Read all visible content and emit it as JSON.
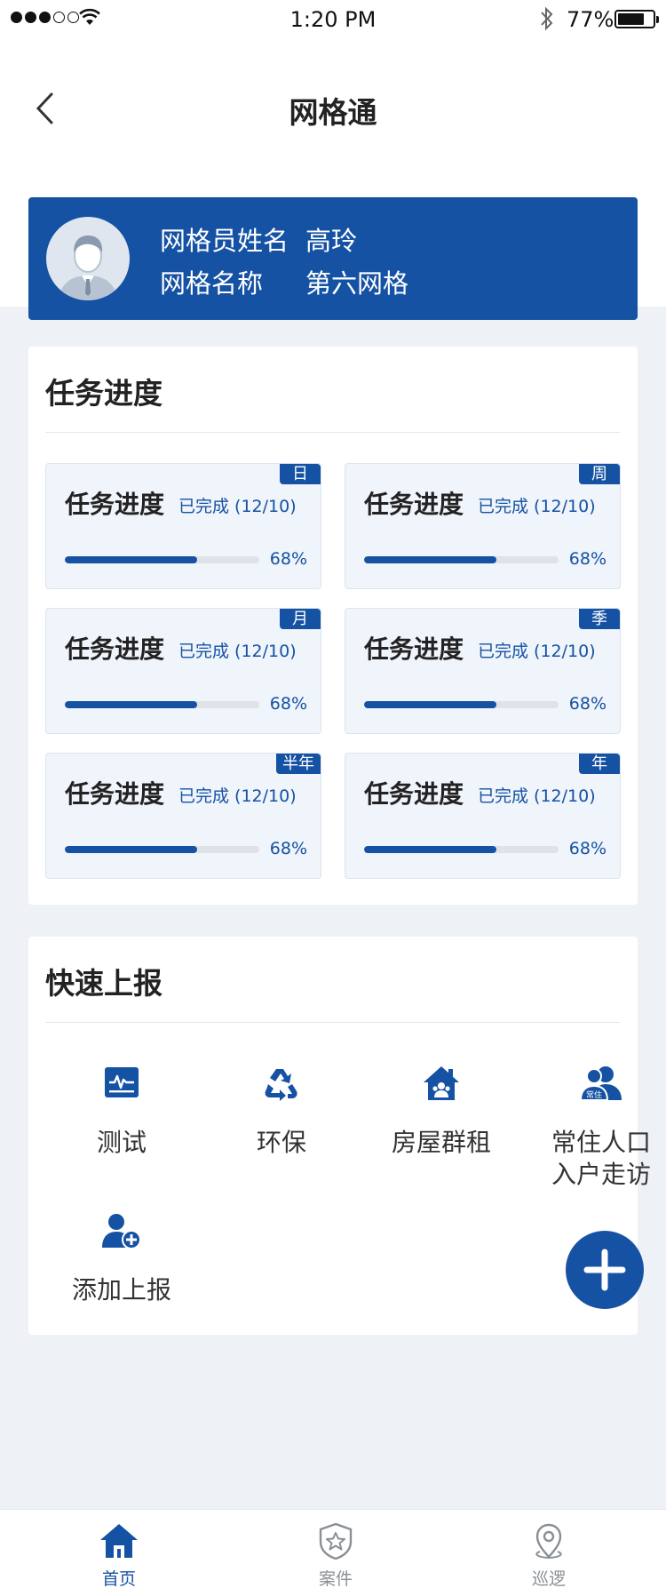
{
  "status_bar": {
    "time": "1:20 PM",
    "battery": "77%"
  },
  "nav": {
    "title": "网格通"
  },
  "profile": {
    "name_label": "网格员姓名",
    "name_value": "高玲",
    "grid_label": "网格名称",
    "grid_value": "第六网格"
  },
  "progress_section": {
    "title": "任务进度",
    "items": [
      {
        "tag": "日",
        "title": "任务进度",
        "done": "已完成 (12/10)",
        "percent": "68%",
        "fraction": 0.68
      },
      {
        "tag": "周",
        "title": "任务进度",
        "done": "已完成 (12/10)",
        "percent": "68%",
        "fraction": 0.68
      },
      {
        "tag": "月",
        "title": "任务进度",
        "done": "已完成 (12/10)",
        "percent": "68%",
        "fraction": 0.68
      },
      {
        "tag": "季",
        "title": "任务进度",
        "done": "已完成 (12/10)",
        "percent": "68%",
        "fraction": 0.68
      },
      {
        "tag": "半年",
        "title": "任务进度",
        "done": "已完成 (12/10)",
        "percent": "68%",
        "fraction": 0.68
      },
      {
        "tag": "年",
        "title": "任务进度",
        "done": "已完成 (12/10)",
        "percent": "68%",
        "fraction": 0.68
      }
    ]
  },
  "quick_report": {
    "title": "快速上报",
    "items": [
      {
        "label": "测试",
        "icon": "monitor-icon"
      },
      {
        "label": "环保",
        "icon": "recycle-icon"
      },
      {
        "label": "房屋群租",
        "icon": "house-group-icon"
      },
      {
        "label": "常住人口入户走访",
        "line1": "常住人口",
        "line2": "入户走访",
        "icon": "resident-users-icon",
        "badge": "常住"
      },
      {
        "label": "添加上报",
        "icon": "add-user-icon"
      }
    ]
  },
  "tabbar": {
    "items": [
      {
        "label": "首页",
        "icon": "home-icon",
        "active": true
      },
      {
        "label": "案件",
        "icon": "shield-star-icon",
        "active": false
      },
      {
        "label": "巡逻",
        "icon": "location-pin-icon",
        "active": false
      }
    ]
  },
  "colors": {
    "primary": "#1552a3",
    "background": "#eef2f6",
    "inactive": "#8a8f96"
  }
}
